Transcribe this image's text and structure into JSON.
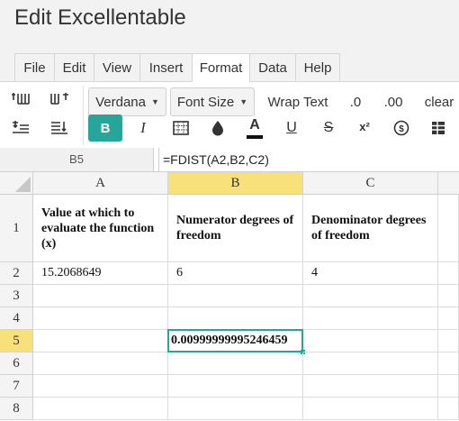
{
  "app": {
    "title": "Edit Excellentable"
  },
  "menu": {
    "tabs": [
      "File",
      "Edit",
      "View",
      "Insert",
      "Format",
      "Data",
      "Help"
    ],
    "active": "Format"
  },
  "toolbar": {
    "font_family": "Verdana",
    "font_size_label": "Font Size",
    "wrap_text": "Wrap Text",
    "decrease_decimal": ".0",
    "increase_decimal": ".00",
    "clear": "clear",
    "bold": "B",
    "italic": "I",
    "font_color_letter": "A",
    "underline": "U",
    "strikethrough": "S",
    "superscript": "x²",
    "accent_color": "#26a69a"
  },
  "formula_bar": {
    "cell_ref": "B5",
    "formula": "=FDIST(A2,B2,C2)"
  },
  "sheet": {
    "columns": [
      "A",
      "B",
      "C"
    ],
    "selected_column": "B",
    "rows": [
      "1",
      "2",
      "3",
      "4",
      "5",
      "6",
      "7",
      "8"
    ],
    "selected_row": "5",
    "cells": {
      "A1": "Value at which to evaluate the function (x)",
      "B1": "Numerator degrees of freedom",
      "C1": "Denominator degrees of freedom",
      "A2": "15.2068649",
      "B2": "6",
      "C2": "4",
      "B5": "0.00999999995246459"
    }
  }
}
